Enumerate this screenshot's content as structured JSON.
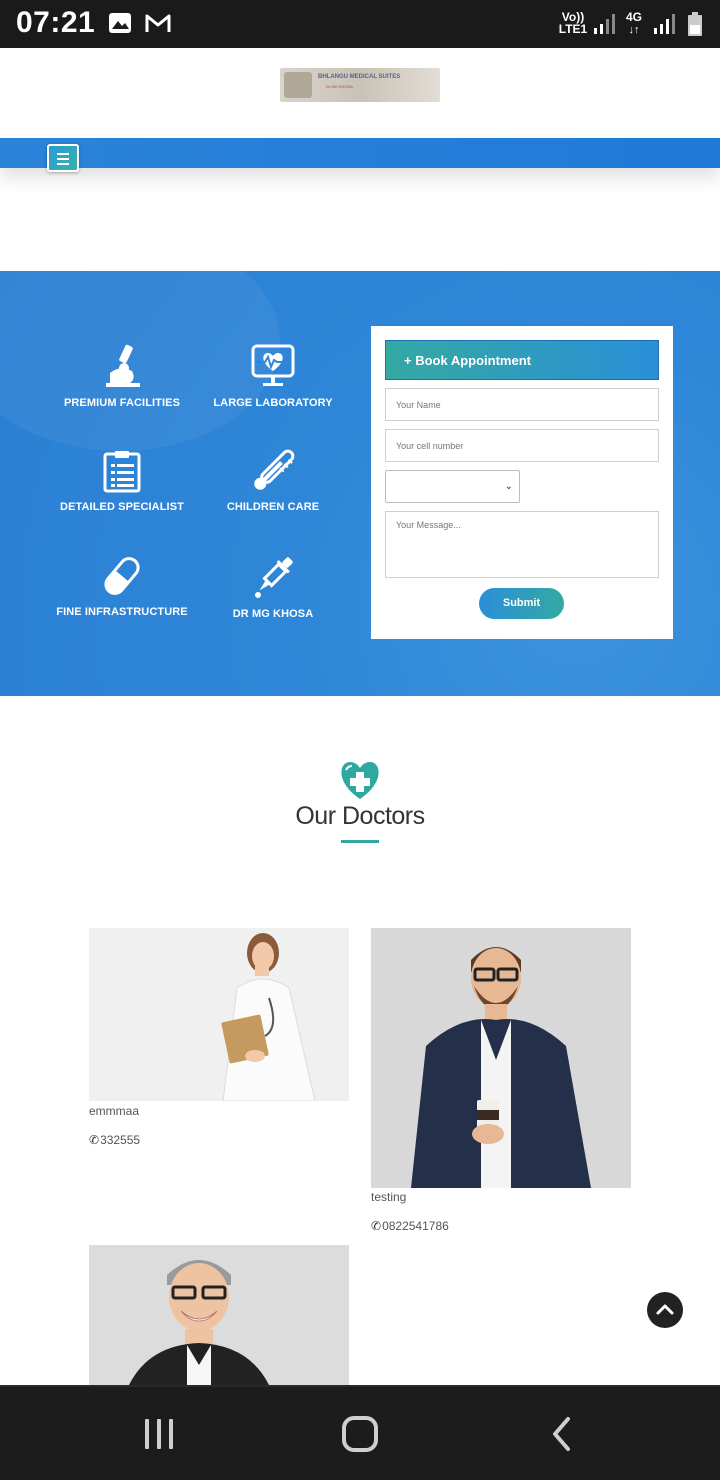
{
  "status_bar": {
    "time": "07:21",
    "left_icons": [
      "image-icon",
      "gmail-icon"
    ],
    "net1_top": "Vo))",
    "net1_bottom": "LTE1",
    "net2_top": "4G",
    "battery": "7"
  },
  "header": {
    "logo_text": "BHLANGU MEDICAL SUITES",
    "logo_subtext": "Dr MG KHOSA"
  },
  "features": [
    {
      "label": "PREMIUM FACILITIES",
      "icon": "microscope-icon"
    },
    {
      "label": "LARGE LABORATORY",
      "icon": "monitor-heart-icon"
    },
    {
      "label": "DETAILED SPECIALIST",
      "icon": "clipboard-icon"
    },
    {
      "label": "CHILDREN CARE",
      "icon": "thermometer-icon"
    },
    {
      "label": "FINE INFRASTRUCTURE",
      "icon": "pill-icon"
    },
    {
      "label": "DR MG KHOSA",
      "icon": "dropper-icon"
    }
  ],
  "form": {
    "title": "+ Book Appointment",
    "name_placeholder": "Your Name",
    "cell_placeholder": "Your cell number",
    "select_value": "",
    "message_placeholder": "Your Message...",
    "submit_label": "Submit"
  },
  "doctors_section": {
    "title": "Our Doctors"
  },
  "doctors": [
    {
      "name": "emmmaa",
      "phone": "332555"
    },
    {
      "name": "testing",
      "phone": "0822541786"
    },
    {
      "name": "",
      "phone": ""
    }
  ],
  "colors": {
    "hero_blue": "#2f87d8",
    "accent_teal": "#37a8a0",
    "nav_blue": "#1f7ad8"
  }
}
